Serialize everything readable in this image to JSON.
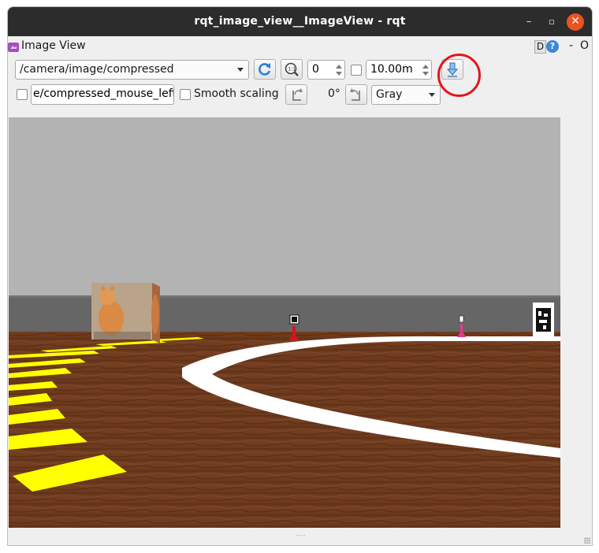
{
  "window": {
    "title": "rqt_image_view__ImageView - rqt",
    "controls": {
      "minimize": "–",
      "maximize": "▫",
      "close": "✕"
    }
  },
  "panel": {
    "title": "Image View",
    "d_button": "D",
    "help_button": "?",
    "dash": "-",
    "close": "O"
  },
  "toolbar": {
    "topic": "/camera/image/compressed",
    "spin_value": "0",
    "max_range": "10.00m",
    "mouse_topic": "e/compressed_mouse_left",
    "smooth_scaling_label": "Smooth scaling",
    "rotation_label": "0°",
    "color_scheme": "Gray",
    "smooth_scaling_checked": false,
    "dynamic_range_checked": false,
    "publish_mouse_checked": false
  },
  "icons": {
    "refresh": "refresh-icon",
    "zoom": "zoom-fit-icon",
    "save": "save-image-icon",
    "rotate_left": "rotate-left-icon",
    "rotate_right": "rotate-right-icon"
  },
  "colors": {
    "titlebar": "#2c2c2c",
    "close_button": "#e95420",
    "highlight_ring": "#e8121b",
    "lane_white": "#ffffff",
    "lane_yellow": "#ffff00",
    "wall": "#666666",
    "sky": "#b3b3b3",
    "floor": "#6b3a1f"
  }
}
